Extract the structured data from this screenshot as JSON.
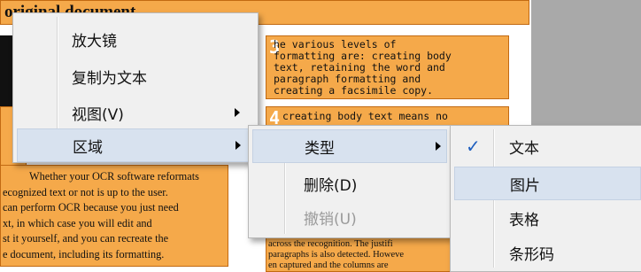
{
  "document": {
    "heading": "original document",
    "block3": {
      "number": "3",
      "lines": [
        "he various levels of",
        "formatting are: creating body",
        "text, retaining the word and",
        "paragraph formatting and",
        "creating a facsimile copy."
      ]
    },
    "block4": {
      "number": "4",
      "line": "creating body text means no"
    },
    "left_paragraph": [
      "Whether your OCR software reformats",
      "ecognized text or not is up to the user.",
      "can perform OCR because you just need",
      "xt, in which case you will edit and",
      "st it yourself, and you can recreate the",
      "e document, including its formatting."
    ],
    "bottom_right": [
      "across the recognition. The justifi",
      "paragraphs is also detected. Howeve",
      "en captured and the columns are"
    ]
  },
  "context_menu": {
    "items": [
      {
        "label": "放大镜"
      },
      {
        "label": "复制为文本"
      },
      {
        "label": "视图(V)"
      },
      {
        "label": "区域"
      }
    ]
  },
  "submenu_region": {
    "items": [
      {
        "label": "类型"
      },
      {
        "label": "删除(D)"
      },
      {
        "label": "撤销(U)"
      }
    ]
  },
  "submenu_type": {
    "check_mark": "✓",
    "items": [
      {
        "label": "文本"
      },
      {
        "label": "图片"
      },
      {
        "label": "表格"
      },
      {
        "label": "条形码"
      }
    ]
  },
  "colors": {
    "region_fill": "#f5a94a",
    "region_border": "#c26a12",
    "menu_bg": "#f0f0f0",
    "highlight": "#d8e2ef",
    "check": "#1f5fbf",
    "grey_panel": "#a9a9a9"
  }
}
